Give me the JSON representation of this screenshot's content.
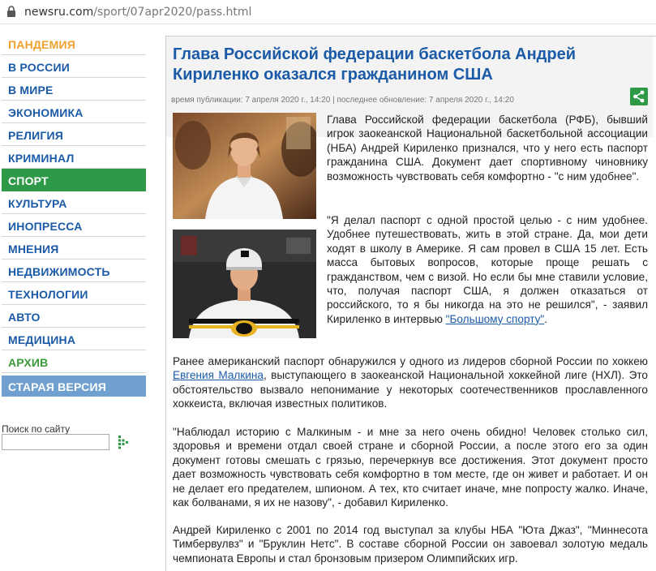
{
  "browser": {
    "url_host": "newsru.com",
    "url_path": "/sport/07apr2020/pass.html"
  },
  "sidebar": {
    "items": [
      {
        "label": "ПАНДЕМИЯ"
      },
      {
        "label": "В РОССИИ"
      },
      {
        "label": "В МИРЕ"
      },
      {
        "label": "ЭКОНОМИКА"
      },
      {
        "label": "РЕЛИГИЯ"
      },
      {
        "label": "КРИМИНАЛ"
      },
      {
        "label": "СПОРТ"
      },
      {
        "label": "КУЛЬТУРА"
      },
      {
        "label": "ИНОПРЕССА"
      },
      {
        "label": "МНЕНИЯ"
      },
      {
        "label": "НЕДВИЖИМОСТЬ"
      },
      {
        "label": "ТЕХНОЛОГИИ"
      },
      {
        "label": "АВТО"
      },
      {
        "label": "МЕДИЦИНА"
      },
      {
        "label": "АРХИВ"
      },
      {
        "label": "СТАРАЯ ВЕРСИЯ"
      }
    ],
    "search_label": "Поиск по сайту",
    "search_placeholder": ""
  },
  "article": {
    "headline": "Глава Российской федерации баскетбола Андрей Кириленко оказался гражданином США",
    "meta": "время публикации: 7 апреля 2020 г., 14:20 | последнее обновление: 7 апреля 2020 г., 14:20",
    "p1": "Глава Российской федерации баскетбола (РФБ), бывший игрок заокеанской Национальной баскетбольной ассоциации (НБА) Андрей Кириленко признался, что у него есть паспорт гражданина США. Документ дает спортивному чиновнику возможность чувствовать себя комфортно - \"с ним удобнее\".",
    "p2_text": "\"Я делал паспорт с одной простой целью - с ним удобнее. Удобнее путешествовать, жить в этой стране. Да, мои дети ходят в школу в Америке. Я сам провел в США 15 лет. Есть масса бытовых вопросов, которые проще решать с гражданством, чем с визой. Но если бы мне ставили условие, что, получая паспорт США, я должен отказаться от российского, то я бы никогда на это не решился\", - заявил Кириленко в интервью ",
    "p2_link": "\"Большому спорту\"",
    "p2_end": ".",
    "p3_start": "Ранее американский паспорт обнаружился у одного из лидеров сборной России по хоккею ",
    "p3_link": "Евгения Малкина",
    "p3_end": ", выступающего в заокеанской Национальной хоккейной лиге (НХЛ). Это обстоятельство вызвало непонимание у некоторых соотечественников прославленного хоккеиста, включая известных политиков.",
    "p4": "\"Наблюдал историю с Малкиным - и мне за него очень обидно! Человек столько сил, здоровья и времени отдал своей стране и сборной России, а после этого его за один документ готовы смешать с грязью, перечеркнув все достижения. Этот документ просто дает возможность чувствовать себя комфортно в том месте, где он живет и работает. И он не делает его предателем, шпионом. А тех, кто считает иначе, мне попросту жалко. Иначе, как болванами, я их не назову\", - добавил Кириленко.",
    "p5": "Андрей Кириленко с 2001 по 2014 год выступал за клубы НБА \"Юта Джаз\", \"Миннесота Тимбервулвз\" и \"Бруклин Нетс\". В составе сборной России он завоевал золотую медаль чемпионата Европы и стал бронзовым призером Олимпийских игр."
  },
  "colors": {
    "link": "#1a5aa6",
    "active_nav": "#2e9a47",
    "old_version": "#6fa0cf",
    "pandemic": "#f0a030"
  }
}
